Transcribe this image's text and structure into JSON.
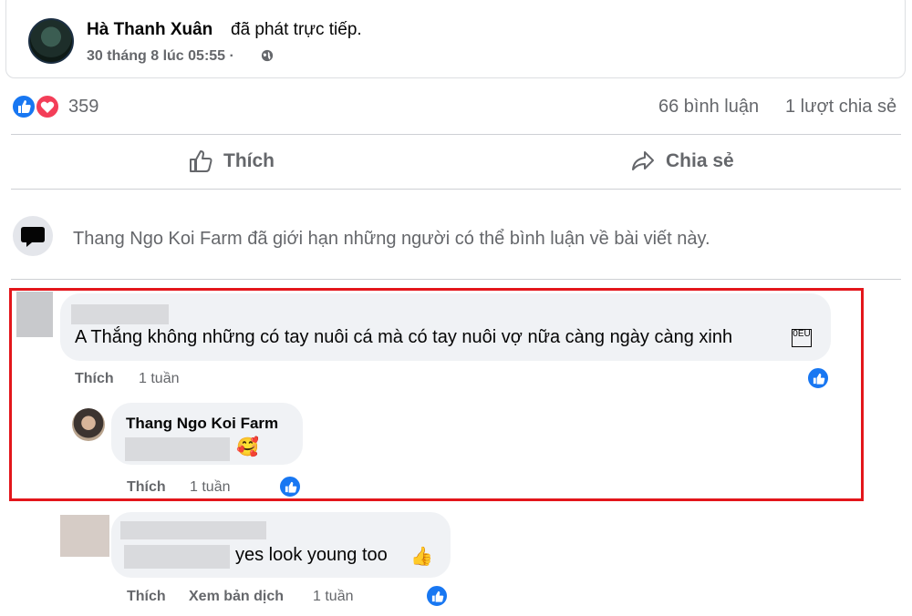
{
  "post": {
    "author": "Hà Thanh Xuân",
    "action": "đã phát trực tiếp.",
    "timestamp": "30 tháng 8 lúc 05:55 ·",
    "privacy_icon": "globe-icon"
  },
  "stats": {
    "reactions_count": "359",
    "comments": "66 bình luận",
    "shares": "1 lượt chia sẻ",
    "reaction_icons": [
      "like-icon",
      "love-icon"
    ]
  },
  "actions": {
    "like": "Thích",
    "share": "Chia sẻ"
  },
  "notice": {
    "text": "Thang Ngo Koi Farm đã giới hạn những người có thể bình luận về bài viết này."
  },
  "comments": [
    {
      "text": "A Thắng không những có tay nuôi cá mà có tay nuôi vợ nữa càng ngày càng xinh",
      "emoji_box": "0EU",
      "like_label": "Thích",
      "time": "1 tuần"
    }
  ],
  "reply": {
    "author": "Thang Ngo Koi Farm",
    "emoji": "🥰",
    "like_label": "Thích",
    "time": "1 tuần"
  },
  "reply2": {
    "text": "yes look young too",
    "emoji": "👍",
    "like_label": "Thích",
    "translate_label": "Xem bản dịch",
    "time": "1 tuần"
  },
  "colors": {
    "facebook_blue": "#1877f2",
    "highlight_red": "#e3161b",
    "muted_text": "#65676b",
    "bubble_bg": "#f0f2f5"
  }
}
